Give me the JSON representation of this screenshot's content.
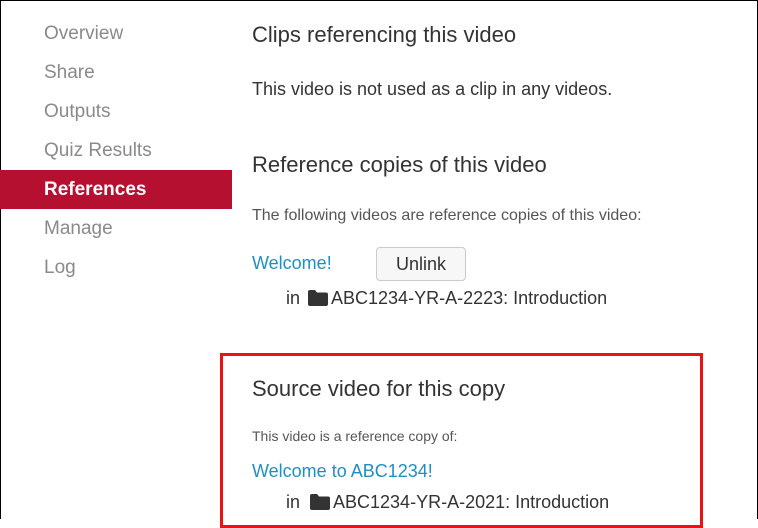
{
  "sidebar": {
    "items": [
      {
        "label": "Overview"
      },
      {
        "label": "Share"
      },
      {
        "label": "Outputs"
      },
      {
        "label": "Quiz Results"
      },
      {
        "label": "References",
        "active": true
      },
      {
        "label": "Manage"
      },
      {
        "label": "Log"
      }
    ]
  },
  "clips": {
    "heading": "Clips referencing this video",
    "message": "This video is not used as a clip in any videos."
  },
  "reference_copies": {
    "heading": "Reference copies of this video",
    "intro": "The following videos are reference copies of this video:",
    "items": [
      {
        "title": "Welcome!",
        "unlink_label": "Unlink",
        "in_label": "in",
        "folder": "ABC1234-YR-A-2223: Introduction"
      }
    ]
  },
  "source": {
    "heading": "Source video for this copy",
    "intro": "This video is a reference copy of:",
    "title": "Welcome to ABC1234!",
    "in_label": "in",
    "folder": "ABC1234-YR-A-2021: Introduction"
  },
  "colors": {
    "accent": "#b5102f",
    "link": "#1e8ec6",
    "highlight": "#ee1111"
  },
  "icons": {
    "folder": "folder-icon"
  }
}
